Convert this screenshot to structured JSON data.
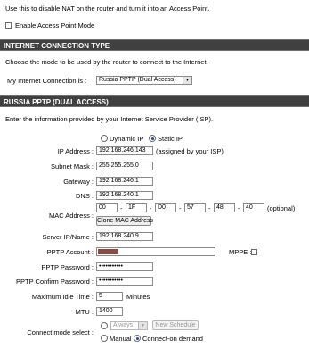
{
  "ap_section": {
    "description": "Use this to disable NAT on the router and turn it into an Access Point.",
    "enable_ap_label": "Enable Access Point Mode"
  },
  "connection_type": {
    "header": "INTERNET CONNECTION TYPE",
    "description": "Choose the mode to be used by the router to connect to the Internet.",
    "label": "My Internet Connection is :",
    "selected": "Russia PPTP (Dual Access)",
    "arrow": "▼"
  },
  "pptp": {
    "header": "RUSSIA PPTP (DUAL ACCESS)",
    "description": "Enter the information provided by your Internet Service Provider (ISP).",
    "dynamic_ip_label": "Dynamic IP",
    "static_ip_label": "Static IP",
    "ip_address_label": "IP Address :",
    "ip_address_value": "192.168.246.143",
    "ip_address_note": "(assigned by your ISP)",
    "subnet_mask_label": "Subnet Mask :",
    "subnet_mask_value": "255.255.255.0",
    "gateway_label": "Gateway :",
    "gateway_value": "192.168.246.1",
    "dns_label": "DNS :",
    "dns_value": "192.168.240.1",
    "mac_label": "MAC Address :",
    "mac_octets": [
      "00",
      "1F",
      "D0",
      "57",
      "48",
      "40"
    ],
    "mac_sep": "-",
    "mac_note": "(optional)",
    "clone_mac_label": "Clone MAC Address",
    "server_label": "Server IP/Name :",
    "server_value": "192.168.240.9",
    "account_label": "PPTP Account :",
    "mppe_label": "MPPE :",
    "password_label": "PPTP Password :",
    "password_value": "•••••••••••",
    "confirm_label": "PPTP Confirm Password :",
    "confirm_value": "•••••••••••",
    "idle_label": "Maximum Idle Time :",
    "idle_value": "5",
    "idle_unit": "Minutes",
    "mtu_label": "MTU :",
    "mtu_value": "1400",
    "connect_mode_label": "Connect mode select :",
    "schedule_selected": "Always",
    "new_schedule_label": "New Schedule",
    "manual_label": "Manual",
    "on_demand_label": "Connect-on demand"
  }
}
